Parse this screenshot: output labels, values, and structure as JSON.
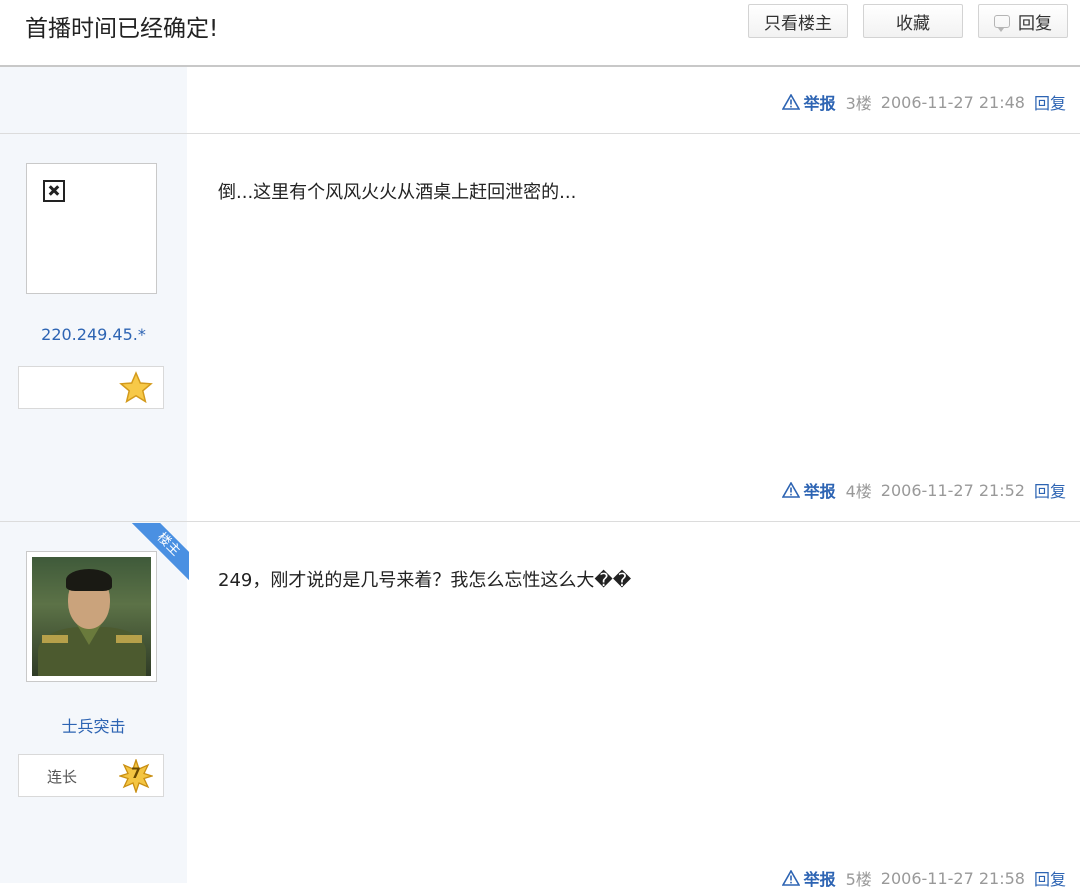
{
  "header": {
    "title": "首播时间已经确定!",
    "buttons": {
      "only_op": "只看楼主",
      "favorite": "收藏",
      "reply": "回复"
    }
  },
  "colors": {
    "link_blue": "#2d64b3",
    "meta_gray": "#999999",
    "sidebar_bg": "#f4f7fb",
    "ribbon_blue": "#4a90e2"
  },
  "posts": [
    {
      "meta": {
        "report": "举报",
        "floor": "3楼",
        "time": "2006-11-27 21:48",
        "reply": "回复"
      }
    },
    {
      "user": {
        "name": "220.249.45.*",
        "avatar": "broken-image-icon",
        "level_name": "",
        "level_num": ""
      },
      "content": "倒...这里有个风风火火从酒桌上赶回泄密的...",
      "meta": {
        "report": "举报",
        "floor": "4楼",
        "time": "2006-11-27 21:52",
        "reply": "回复"
      }
    },
    {
      "user": {
        "name": "士兵突击",
        "avatar": "user-photo",
        "level_name": "连长",
        "level_num": "7",
        "badge": "楼主"
      },
      "content": "249，刚才说的是几号来着？我怎么忘性这么大��",
      "meta": {
        "report": "举报",
        "floor": "5楼",
        "time": "2006-11-27 21:58",
        "reply": "回复"
      }
    }
  ]
}
